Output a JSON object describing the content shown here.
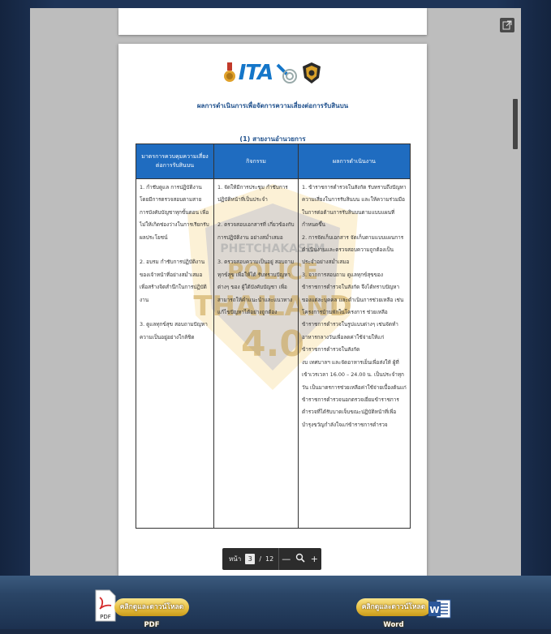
{
  "viewer": {
    "current_page": "3",
    "page_separator": "/",
    "total_pages": "12",
    "page_label": "หน้า",
    "zoom_out_symbol": "—",
    "zoom_in_symbol": "+"
  },
  "document": {
    "logo_text": "ITA",
    "title": "ผลการดำเนินการเพื่อจัดการความเสี่ยงต่อการรับสินบน",
    "subtitle": "(1) สายงานอำนวยการ",
    "watermark": {
      "line1": "PHETCHAKASEM",
      "line2": "POLICE",
      "line3": "THAILAND",
      "line4": "4.0"
    },
    "table": {
      "headers": [
        "มาตรการควบคุมความเสี่ยงต่อการรับสินบน",
        "กิจกรรม",
        "ผลการดำเนินงาน"
      ],
      "col1": "1. กำชับดูแล การปฏิบัติงานโดยมีการตรวจสอบตามสายการบังคับบัญชาทุกขั้นตอน เพื่อไม่ให้เกิดช่องว่างในการเรียกรับผลประโยชน์\n\n2. อบรม กำชับการปฏิบัติงานของเจ้าหน้าที่อย่างสม่ำเสมอ เพื่อสร้างจิตสำนึกในการปฏิบัติงาน\n\n3. ดูแลทุกข์สุข สอบถามปัญหาความเป็นอยู่อย่างใกล้ชิด",
      "col2": "1. จัดให้มีการประชุม กำชับการปฏิบัติหน้าที่เป็นประจำ\n\n2. ตรวจสอบเอกสารที่ เกี่ยวข้องกับการปฏิบัติงาน อย่างสม่ำเสมอ\n\n3. ตรวจสอบความเป็นอยู่ สอบถามทุกข์สุข เพื่อให้ได้ รับทราบปัญหาต่างๆ ของ ผู้ใต้บังคับบัญชา เพื่อสามารถให้คำแนะนำและแนวทางแก้ไขปัญหาได้อย่างถูกต้อง",
      "col3": "1. ข้าราชการตำรวจในสังกัด รับทราบถึงปัญหาความเสี่ยงในการรับสินบน และให้ความร่วมมือในการต่อต้านการรับสินบนตามแบบแผนที่กำหนดขึ้น\n2. การจัดเก็บเอกสาร จัดเก็บตามแบบแผนการดำเนินงานและตรวจสอบความถูกต้องเป็นประจำอย่างสม่ำเสมอ\n3. จากการสอบถาม ดูแลทุกข์สุขของข้าราชการตำรวจในสังกัด จึงได้ทราบปัญหาของแต่ละบุคคล และดำเนินการช่วยเหลือ เช่นโครงการบ้านพักในโครงการ ช่วยเหลือข้าราชการตำรวจในรูปแบบต่างๆ เช่นจัดทำอาหารกลางวันเพื่อลดค่าใช้จ่ายให้แก่ข้าราชการตำรวจในสังกัด\nงบ เทศบาลฯ และจัดอาหารเย็นเพื่อส่งให้ ผู้ที่เข้าเวรเวลา 16.00 – 24.00 น. เป็นประจำทุกวัน เป็นมาตรการช่วยเหลือค่าใช้จ่ายเบื้องต้นแก่ข้าราชการตำรวจนอกตรวจเยี่ยมข้าราชการตำรวจที่ได้รับบาดเจ็บขณะปฏิบัติหน้าที่เพื่อบำรุงขวัญกำลังใจแก่ข้าราชการตำรวจ"
    }
  },
  "downloads": {
    "pdf_label": "คลิกดูและดาวน์โหลด PDF",
    "word_label": "คลิกดูและดาวน์โหลด Word",
    "pdf_icon_text": "PDF",
    "word_icon_text": "W"
  },
  "colors": {
    "table_header": "#1f6cc0",
    "title_text": "#1d4f8c",
    "button_gold": "#e8c043"
  }
}
